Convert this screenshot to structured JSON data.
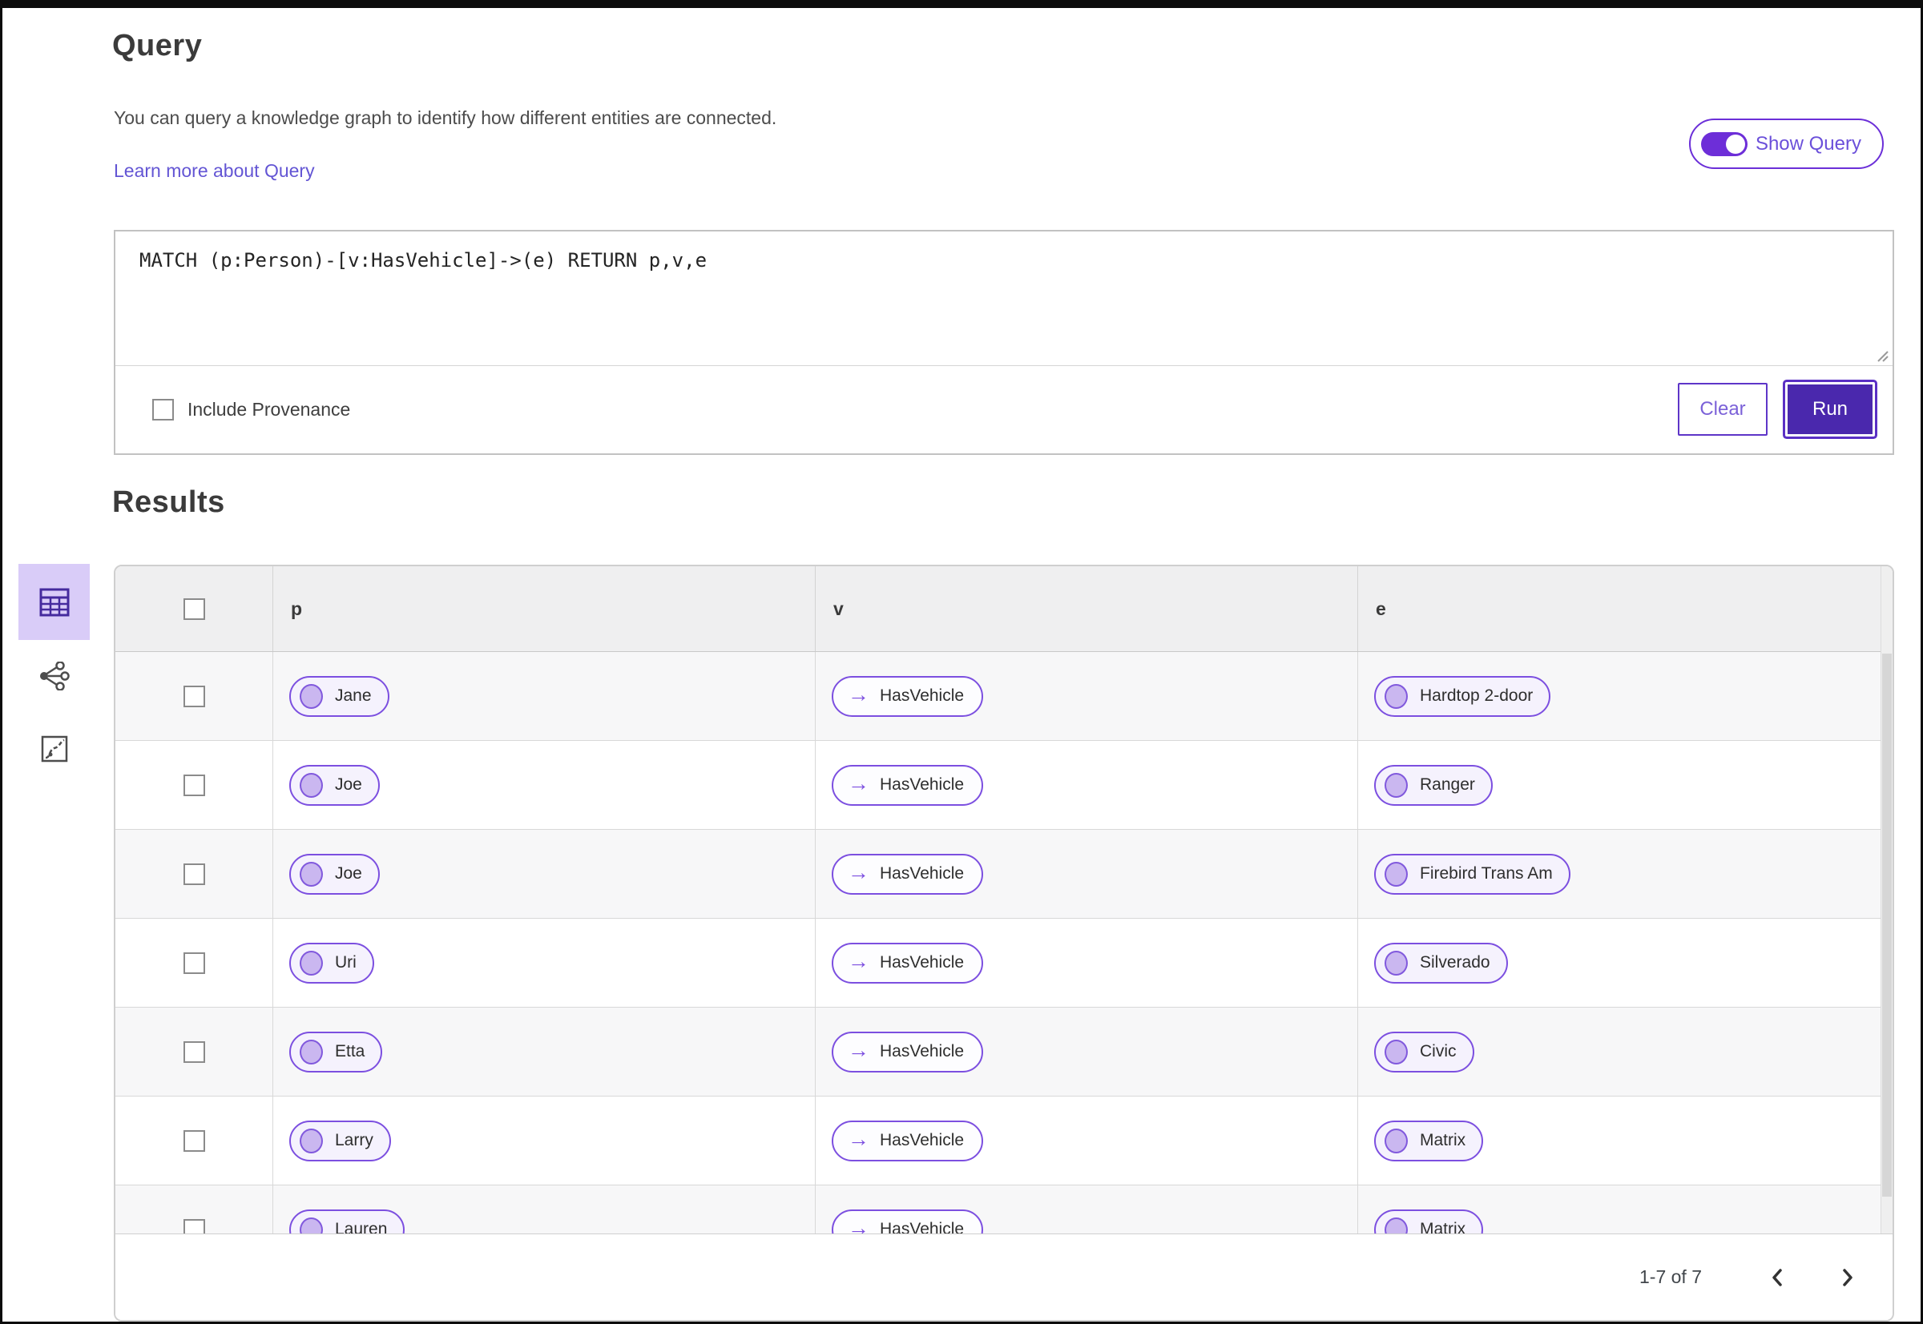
{
  "header": {
    "title": "Query",
    "description": "You can query a knowledge graph to identify how different entities are connected.",
    "learn_more_label": "Learn more about Query",
    "show_query_label": "Show Query",
    "show_query_state": "on"
  },
  "query_editor": {
    "text": "MATCH (p:Person)-[v:HasVehicle]->(e) RETURN p,v,e",
    "include_provenance_label": "Include Provenance",
    "include_provenance_checked": false,
    "clear_label": "Clear",
    "run_label": "Run"
  },
  "results": {
    "title": "Results",
    "view_tabs": [
      {
        "name": "table-view",
        "icon": "table-icon",
        "selected": true
      },
      {
        "name": "graph-view",
        "icon": "graph-network-icon",
        "selected": false
      },
      {
        "name": "path-view",
        "icon": "path-chart-icon",
        "selected": false
      }
    ],
    "columns": [
      "p",
      "v",
      "e"
    ],
    "rows": [
      {
        "p": "Jane",
        "v": "HasVehicle",
        "e": "Hardtop 2-door"
      },
      {
        "p": "Joe",
        "v": "HasVehicle",
        "e": "Ranger"
      },
      {
        "p": "Joe",
        "v": "HasVehicle",
        "e": "Firebird Trans Am"
      },
      {
        "p": "Uri",
        "v": "HasVehicle",
        "e": "Silverado"
      },
      {
        "p": "Etta",
        "v": "HasVehicle",
        "e": "Civic"
      },
      {
        "p": "Larry",
        "v": "HasVehicle",
        "e": "Matrix"
      },
      {
        "p": "Lauren",
        "v": "HasVehicle",
        "e": "Matrix"
      }
    ],
    "pagination": {
      "range": "1-7 of 7"
    }
  },
  "colors": {
    "accent_deep_purple": "#4a28ad",
    "accent_purple": "#7c4fe0",
    "toggle_purple": "#6d2ed8",
    "link_purple": "#6355d4",
    "pill_background": "#f5f2fd",
    "pill_dot": "#cab7f0",
    "selected_tab_background": "#d9ccf8",
    "header_row_background": "#efeff0",
    "alt_row_background": "#f7f7f8"
  }
}
